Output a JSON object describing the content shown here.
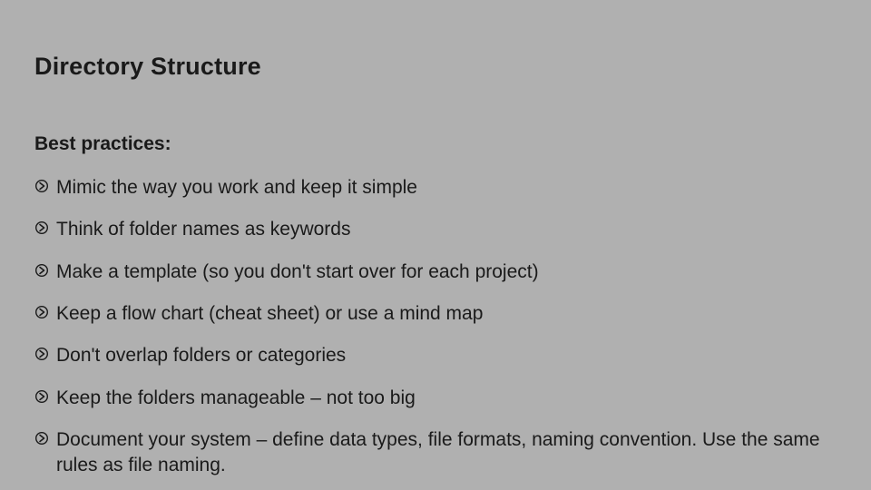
{
  "title": "Directory Structure",
  "subtitle": "Best practices:",
  "bullets": [
    "Mimic the way you work and keep it simple",
    "Think of folder names as keywords",
    "Make a template (so you don't start over for each project)",
    "Keep a flow chart (cheat sheet) or use a mind map",
    "Don't overlap folders or categories",
    "Keep the folders manageable – not too big",
    "Document your system – define data types, file formats, naming convention. Use the same rules as file naming."
  ]
}
